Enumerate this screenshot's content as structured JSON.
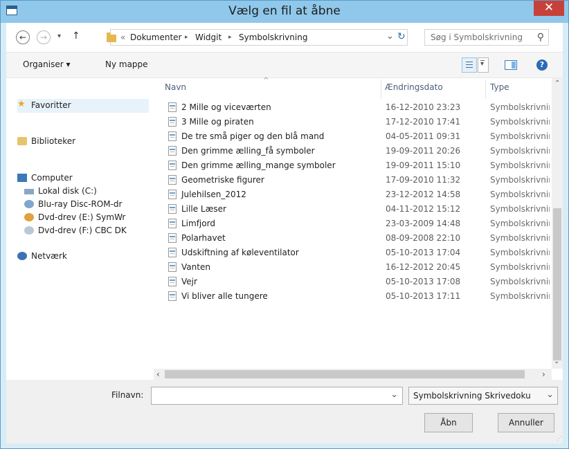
{
  "window": {
    "title": "Vælg en fil at åbne",
    "close_glyph": "✕"
  },
  "nav": {
    "back_glyph": "←",
    "forward_glyph": "→",
    "recent_glyph": "▾",
    "up_glyph": "↑"
  },
  "address": {
    "overflow_glyph": "«",
    "crumbs": [
      "Dokumenter",
      "Widgit",
      "Symbolskrivning"
    ],
    "separator": "▸",
    "dropdown_glyph": "⌄",
    "refresh_glyph": "↻"
  },
  "search": {
    "placeholder": "Søg i Symbolskrivning",
    "icon_glyph": "⚲"
  },
  "toolbar": {
    "organize_label": "Organiser ▾",
    "new_folder_label": "Ny mappe",
    "view_dropdown_glyph": "▾",
    "help_glyph": "?"
  },
  "sidebar": {
    "favorites": "Favoritter",
    "libraries": "Biblioteker",
    "computer": "Computer",
    "drives": [
      "Lokal disk (C:)",
      "Blu-ray Disc-ROM-dr",
      "Dvd-drev (E:) SymWr",
      "Dvd-drev (F:) CBC DK"
    ],
    "network": "Netværk"
  },
  "columns": {
    "name": "Navn",
    "date": "Ændringsdato",
    "type": "Type"
  },
  "files": [
    {
      "name": "2 Mille og viceværten",
      "date": "16-12-2010 23:23",
      "type": "Symbolskrivnir"
    },
    {
      "name": "3 Mille og piraten",
      "date": "17-12-2010 17:41",
      "type": "Symbolskrivnir"
    },
    {
      "name": "De tre små piger og den blå mand",
      "date": "04-05-2011 09:31",
      "type": "Symbolskrivnir"
    },
    {
      "name": "Den grimme ælling_få symboler",
      "date": "19-09-2011 20:26",
      "type": "Symbolskrivnir"
    },
    {
      "name": "Den grimme ælling_mange symboler",
      "date": "19-09-2011 15:10",
      "type": "Symbolskrivnir"
    },
    {
      "name": "Geometriske figurer",
      "date": "17-09-2010 11:32",
      "type": "Symbolskrivnir"
    },
    {
      "name": "Julehilsen_2012",
      "date": "23-12-2012 14:58",
      "type": "Symbolskrivnir"
    },
    {
      "name": "Lille Læser",
      "date": "04-11-2012 15:12",
      "type": "Symbolskrivnir"
    },
    {
      "name": "Limfjord",
      "date": "23-03-2009 14:48",
      "type": "Symbolskrivnir"
    },
    {
      "name": "Polarhavet",
      "date": "08-09-2008 22:10",
      "type": "Symbolskrivnir"
    },
    {
      "name": "Udskiftning af køleventilator",
      "date": "05-10-2013 17:04",
      "type": "Symbolskrivnir"
    },
    {
      "name": "Vanten",
      "date": "16-12-2012 20:45",
      "type": "Symbolskrivnir"
    },
    {
      "name": "Vejr",
      "date": "05-10-2013 17:08",
      "type": "Symbolskrivnir"
    },
    {
      "name": "Vi bliver alle tungere",
      "date": "05-10-2013 17:11",
      "type": "Symbolskrivnir"
    }
  ],
  "scroll": {
    "up": "⌃",
    "down": "⌄",
    "left": "‹",
    "right": "›"
  },
  "footer": {
    "filename_label": "Filnavn:",
    "filename_value": "",
    "filename_dropdown": "⌄",
    "filter_value": "Symbolskrivning Skrivedoku",
    "filter_dropdown": "⌄",
    "open_label": "Åbn",
    "cancel_label": "Annuller"
  }
}
